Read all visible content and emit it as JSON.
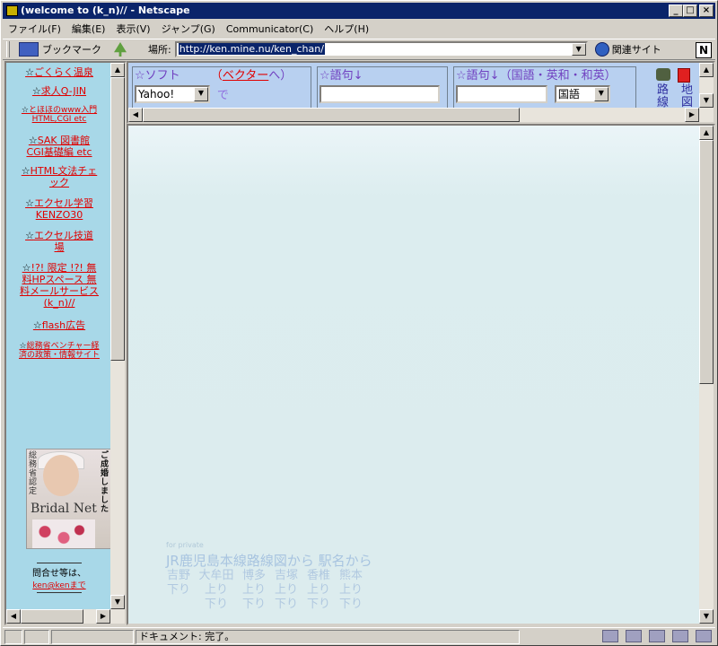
{
  "window": {
    "title": "(welcome to (k_n)// - Netscape"
  },
  "menu": [
    "ファイル(F)",
    "編集(E)",
    "表示(V)",
    "ジャンプ(G)",
    "Communicator(C)",
    "ヘルプ(H)"
  ],
  "toolbar": {
    "bookmarks_label": "ブックマーク",
    "location_label": "場所:",
    "url": "http://ken.mine.nu/ken_chan/",
    "related_label": "関連サイト"
  },
  "left_links": [
    {
      "text": "ごくらく温泉",
      "small": false
    },
    {
      "text": "求人Q-JIN",
      "small": false
    },
    {
      "text": "とほほのwww入門 HTML,CGI etc",
      "small": true
    },
    {
      "text": "SAK 図書館 CGI基礎編 etc",
      "small": false
    },
    {
      "text": "HTML文法チェック",
      "small": false
    },
    {
      "text": "エクセル学習 KENZO30",
      "small": false
    },
    {
      "text": "エクセル技道場",
      "small": false
    },
    {
      "text": "!?! 限定 !?! 無料HPスペース 無料メールサービス (k_n)//",
      "small": false
    },
    {
      "text": "flash広告",
      "small": false
    },
    {
      "text": "総務省ベンチャー経済の政策・情報サイト",
      "small": true
    }
  ],
  "ad": {
    "vertical_left": "総務省認定",
    "brand": "Bridal Net",
    "vertical_right": "ご成婚しました"
  },
  "contact": {
    "label": "問合せ等は、",
    "link": "ken@kenまで"
  },
  "search": {
    "soft_label": "☆ソフト",
    "vector_link": "ベクター",
    "vector_paren_open": "（",
    "vector_paren_close": "へ）",
    "engine_selected": "Yahoo!",
    "de": "で",
    "phrase1_label": "☆語句↓",
    "phrase2_label": "☆語句↓",
    "phrase2_hint": "（国語・英和・和英）",
    "dict_selected": "国語",
    "route_label": "路線",
    "map_label": "地図"
  },
  "main": {
    "for_private": "for private",
    "jr_text": "JR鹿児島本線路線図から 駅名から",
    "stations": [
      {
        "name": "吉野",
        "dir": "下り"
      },
      {
        "name": "大牟田",
        "dir": "上り 下り"
      },
      {
        "name": "博多",
        "dir": "上り 下り"
      },
      {
        "name": "吉塚",
        "dir": "上り 下り"
      },
      {
        "name": "香椎",
        "dir": "上り 下り"
      },
      {
        "name": "熊本",
        "dir": "上り 下り"
      }
    ]
  },
  "status": {
    "text": "ドキュメント: 完了。"
  }
}
